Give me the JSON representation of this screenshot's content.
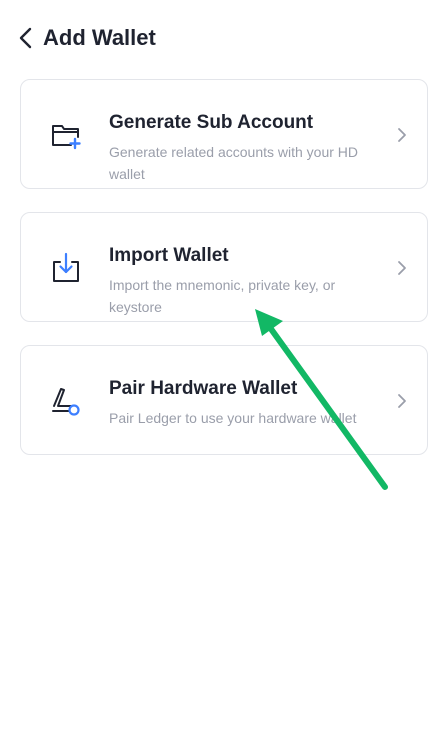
{
  "header": {
    "title": "Add Wallet",
    "back_icon": "chevron-left-icon"
  },
  "options": [
    {
      "title": "Generate Sub Account",
      "description": "Generate related accounts with your HD wallet",
      "icon": "folder-plus-icon"
    },
    {
      "title": "Import Wallet",
      "description": "Import the mnemonic, private key, or keystore",
      "icon": "import-download-icon"
    },
    {
      "title": "Pair Hardware Wallet",
      "description": "Pair Ledger to use your hardware wallet",
      "icon": "hardware-device-icon"
    }
  ],
  "colors": {
    "accent_blue": "#3d7fff",
    "icon_dark": "#1f2330",
    "annotation_arrow": "#12b865"
  }
}
